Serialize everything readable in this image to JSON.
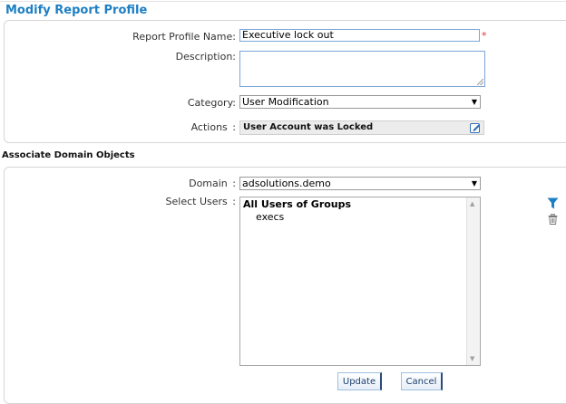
{
  "page": {
    "title": "Modify Report Profile"
  },
  "form": {
    "profile_name_label": "Report Profile Name:",
    "profile_name_value": "Executive lock out",
    "required_marker": "*",
    "description_label": "Description:",
    "description_value": "",
    "category_label": "Category:",
    "category_value": "User Modification",
    "actions_label": "Actions",
    "actions_colon": ":",
    "actions_value": "User Account was Locked"
  },
  "domain_section": {
    "heading": "Associate Domain Objects",
    "domain_label": "Domain",
    "domain_colon": ":",
    "domain_value": "adsolutions.demo",
    "select_users_label": "Select Users",
    "select_users_colon": ":",
    "users_list": {
      "group_header": "All Users of Groups",
      "items": [
        "execs"
      ]
    }
  },
  "buttons": {
    "update": "Update",
    "cancel": "Cancel"
  },
  "icons": {
    "dropdown": "chevron-down-icon",
    "edit": "edit-icon",
    "filter": "filter-icon",
    "trash": "trash-icon"
  },
  "colors": {
    "title": "#1d7fc4",
    "required": "#e03030",
    "filter_icon": "#1d7fc4"
  }
}
